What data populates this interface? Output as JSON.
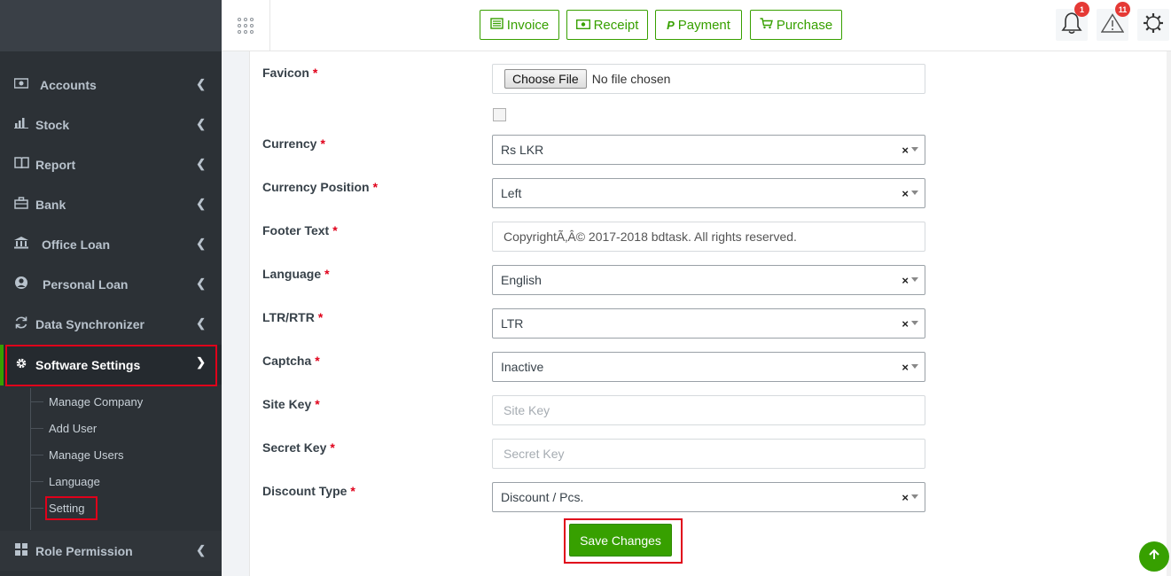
{
  "header": {
    "buttons": [
      {
        "label": "Invoice",
        "icon": "invoice-icon"
      },
      {
        "label": "Receipt",
        "icon": "money-icon"
      },
      {
        "label": "Payment",
        "icon": "paypal-icon"
      },
      {
        "label": "Purchase",
        "icon": "cart-icon"
      }
    ],
    "notifications_count": "1",
    "alerts_count": "11"
  },
  "sidebar": {
    "items": [
      {
        "label": "Accounts",
        "icon": "money-icon"
      },
      {
        "label": "Stock",
        "icon": "bar-chart-icon"
      },
      {
        "label": "Report",
        "icon": "book-icon"
      },
      {
        "label": "Bank",
        "icon": "briefcase-icon"
      },
      {
        "label": "Office Loan",
        "icon": "bank-icon"
      },
      {
        "label": "Personal Loan",
        "icon": "user-circle-icon"
      },
      {
        "label": "Data Synchronizer",
        "icon": "sync-icon"
      },
      {
        "label": "Software Settings",
        "icon": "gear-icon"
      },
      {
        "label": "Role Permission",
        "icon": "lock-icon"
      }
    ],
    "submenu": [
      "Manage Company",
      "Add User",
      "Manage Users",
      "Language",
      "Setting"
    ]
  },
  "form": {
    "favicon_label": "Favicon",
    "choose_file": "Choose File",
    "no_file": "No file chosen",
    "currency_label": "Currency",
    "currency_value": "Rs LKR",
    "currency_position_label": "Currency Position",
    "currency_position_value": "Left",
    "footer_text_label": "Footer Text",
    "footer_text_value": "CopyrightÃ‚Â© 2017-2018 bdtask. All rights reserved.",
    "language_label": "Language",
    "language_value": "English",
    "ltr_label": "LTR/RTR",
    "ltr_value": "LTR",
    "captcha_label": "Captcha",
    "captcha_value": "Inactive",
    "site_key_label": "Site Key",
    "site_key_placeholder": "Site Key",
    "secret_key_label": "Secret Key",
    "secret_key_placeholder": "Secret Key",
    "discount_type_label": "Discount Type",
    "discount_type_value": "Discount / Pcs.",
    "required_mark": "*",
    "clear_mark": "×",
    "save_label": "Save Changes"
  }
}
